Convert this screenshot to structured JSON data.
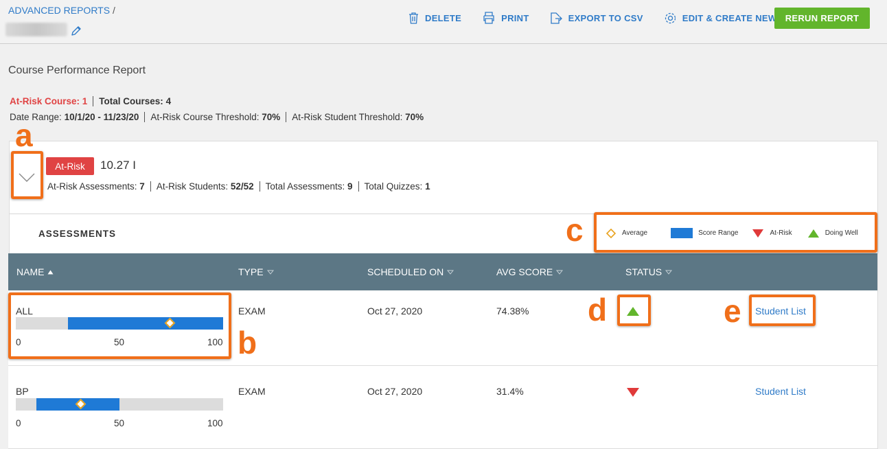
{
  "header": {
    "breadcrumb_link": "ADVANCED REPORTS",
    "breadcrumb_sep": "/",
    "toolbar": [
      {
        "label": "DELETE",
        "icon": "trash-icon"
      },
      {
        "label": "PRINT",
        "icon": "printer-icon"
      },
      {
        "label": "EXPORT TO CSV",
        "icon": "export-icon"
      },
      {
        "label": "EDIT & CREATE NEW",
        "icon": "gear-icon"
      }
    ],
    "rerun_label": "RERUN REPORT"
  },
  "report": {
    "title": "Course Performance Report",
    "at_risk_course_label": "At-Risk Course: 1",
    "total_courses_label": "Total Courses:",
    "total_courses_value": "4",
    "date_range_label": "Date Range:",
    "date_range_value": "10/1/20 - 11/23/20",
    "course_threshold_label": "At-Risk Course Threshold:",
    "course_threshold_value": "70%",
    "student_threshold_label": "At-Risk Student Threshold:",
    "student_threshold_value": "70%"
  },
  "course": {
    "badge": "At-Risk",
    "name": "10.27 I",
    "stats": [
      {
        "label": "At-Risk Assessments:",
        "value": "7"
      },
      {
        "label": "At-Risk Students:",
        "value": "52/52"
      },
      {
        "label": "Total Assessments:",
        "value": "9"
      },
      {
        "label": "Total Quizzes:",
        "value": "1"
      }
    ]
  },
  "assessments": {
    "title": "ASSESSMENTS",
    "legend": {
      "average": "Average",
      "score_range": "Score Range",
      "at_risk": "At-Risk",
      "doing_well": "Doing Well"
    },
    "columns": {
      "name": "NAME",
      "type": "TYPE",
      "scheduled": "SCHEDULED ON",
      "avg": "AVG SCORE",
      "status": "STATUS"
    },
    "scale_ticks": [
      "0",
      "50",
      "100"
    ],
    "rows": [
      {
        "name": "ALL",
        "type": "EXAM",
        "scheduled": "Oct 27, 2020",
        "avg": "74.38%",
        "status": "doing-well",
        "range_min": 25,
        "range_max": 100,
        "avg_value": 74.38,
        "link": "Student List"
      },
      {
        "name": "BP",
        "type": "EXAM",
        "scheduled": "Oct 27, 2020",
        "avg": "31.4%",
        "status": "at-risk",
        "range_min": 10,
        "range_max": 50,
        "avg_value": 31.4,
        "link": "Student List"
      }
    ]
  },
  "annotations": {
    "a": "a",
    "b": "b",
    "c": "c",
    "d": "d",
    "e": "e"
  },
  "colors": {
    "accent_blue": "#2f7bc8",
    "rerun_green": "#62b52c",
    "at_risk_red": "#e04343",
    "table_header": "#5c7785",
    "score_range": "#1f7ad6",
    "average_marker": "#e8a21d",
    "doing_well_green": "#62b52c",
    "annotation_orange": "#f06f1a"
  }
}
